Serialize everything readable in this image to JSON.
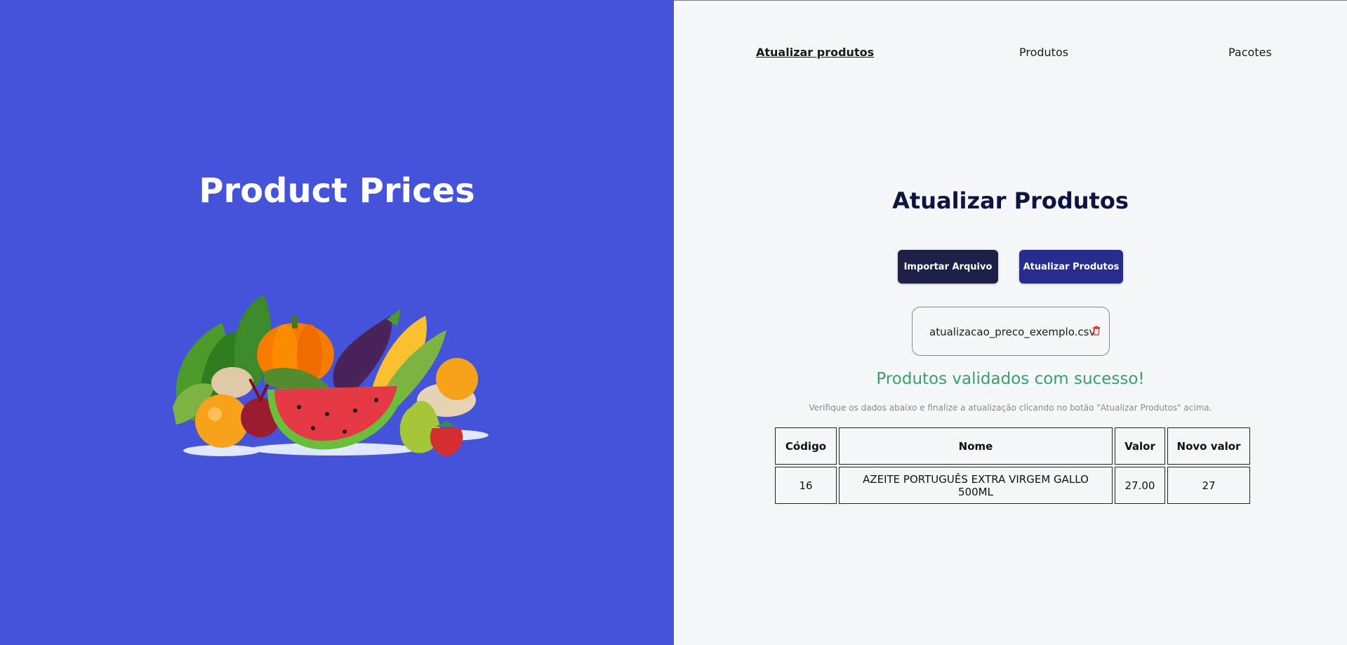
{
  "brand": {
    "title": "Product Prices"
  },
  "nav": {
    "items": [
      {
        "label": "Atualizar produtos",
        "active": true
      },
      {
        "label": "Produtos",
        "active": false
      },
      {
        "label": "Pacotes",
        "active": false
      }
    ]
  },
  "main": {
    "title": "Atualizar Produtos",
    "import_button": "Importar Arquivo",
    "update_button": "Atualizar Produtos",
    "file": {
      "name": "atualizacao_preco_exemplo.csv",
      "icon": "trash-icon"
    },
    "success_message": "Produtos validados com sucesso!",
    "hint": "Verifique os dados abaixo e finalize a atualização clicando no botão \"Atualizar Produtos\" acima."
  },
  "table": {
    "headers": [
      "Código",
      "Nome",
      "Valor",
      "Novo valor"
    ],
    "rows": [
      [
        "16",
        "AZEITE PORTUGUÊS EXTRA VIRGEM GALLO 500ML",
        "27.00",
        "27"
      ]
    ]
  },
  "colors": {
    "left_panel_bg": "#4453d9",
    "success": "#3aa06a",
    "import_button_bg": "#1e2147",
    "update_button_bg": "#262d8c",
    "delete_icon": "#e53935"
  }
}
